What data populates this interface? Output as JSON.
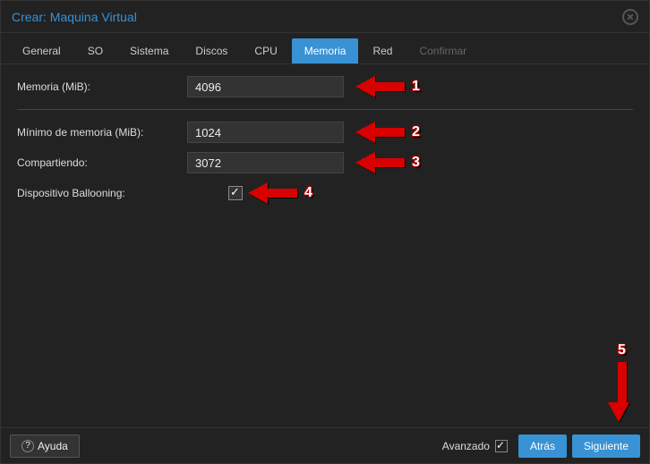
{
  "window": {
    "title": "Crear: Maquina Virtual"
  },
  "tabs": {
    "general": "General",
    "so": "SO",
    "sistema": "Sistema",
    "discos": "Discos",
    "cpu": "CPU",
    "memoria": "Memoria",
    "red": "Red",
    "confirmar": "Confirmar",
    "active": "memoria"
  },
  "form": {
    "memoria_label": "Memoria (MiB):",
    "memoria_value": "4096",
    "min_label": "Mínimo de memoria (MiB):",
    "min_value": "1024",
    "share_label": "Compartiendo:",
    "share_value": "3072",
    "balloon_label": "Dispositivo Ballooning:",
    "balloon_checked": true
  },
  "annotations": {
    "a1": "1",
    "a2": "2",
    "a3": "3",
    "a4": "4",
    "a5": "5"
  },
  "footer": {
    "help": "Ayuda",
    "advanced_label": "Avanzado",
    "advanced_checked": true,
    "back": "Atrás",
    "next": "Siguiente"
  }
}
